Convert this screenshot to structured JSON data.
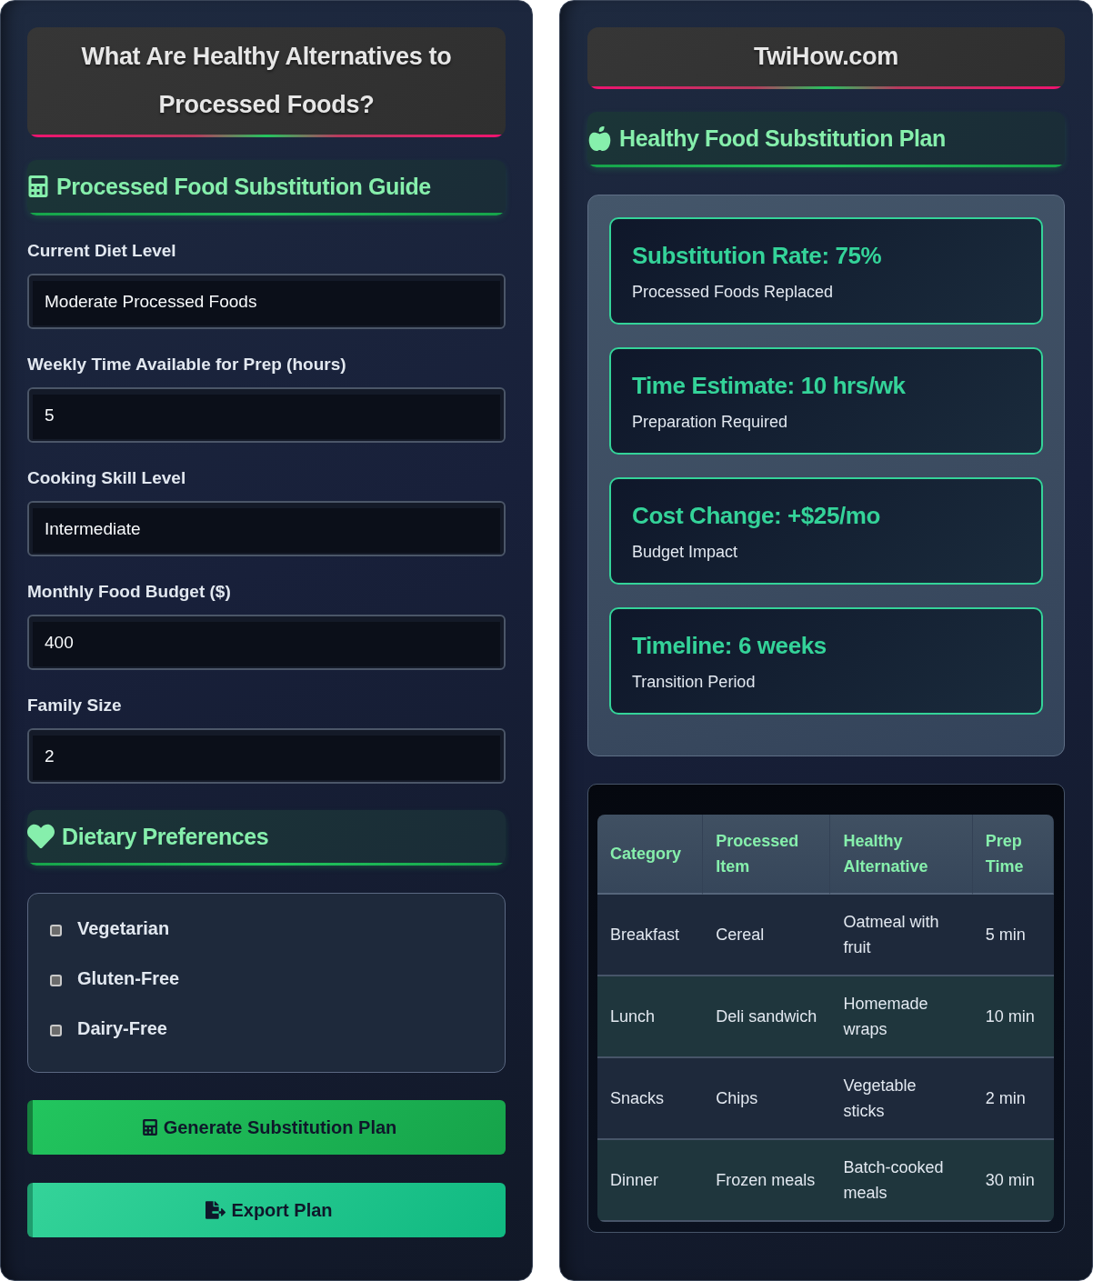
{
  "left_panel": {
    "title": "What Are Healthy Alternatives to Processed Foods?",
    "guide_header": "Processed Food Substitution Guide",
    "fields": [
      {
        "label": "Current Diet Level",
        "value": "Moderate Processed Foods"
      },
      {
        "label": "Weekly Time Available for Prep (hours)",
        "value": "5"
      },
      {
        "label": "Cooking Skill Level",
        "value": "Intermediate"
      },
      {
        "label": "Monthly Food Budget ($)",
        "value": "400"
      },
      {
        "label": "Family Size",
        "value": "2"
      }
    ],
    "preferences_header": "Dietary Preferences",
    "preferences": [
      {
        "label": "Vegetarian",
        "checked": false
      },
      {
        "label": "Gluten-Free",
        "checked": false
      },
      {
        "label": "Dairy-Free",
        "checked": false
      }
    ],
    "buttons": [
      {
        "kind": "generate",
        "label": "Generate Substitution Plan"
      },
      {
        "kind": "export",
        "label": "Export Plan"
      }
    ]
  },
  "right_panel": {
    "site_title": "TwiHow.com",
    "plan_header": "Healthy Food Substitution Plan",
    "results": [
      {
        "title": "Substitution Rate: 75%",
        "caption": "Processed Foods Replaced"
      },
      {
        "title": "Time Estimate: 10 hrs/wk",
        "caption": "Preparation Required"
      },
      {
        "title": "Cost Change: +$25/mo",
        "caption": "Budget Impact"
      },
      {
        "title": "Timeline: 6 weeks",
        "caption": "Transition Period"
      }
    ],
    "table": {
      "columns": [
        "Category",
        "Processed Item",
        "Healthy Alternative",
        "Prep Time"
      ],
      "rows": [
        [
          "Breakfast",
          "Cereal",
          "Oatmeal with fruit",
          "5 min"
        ],
        [
          "Lunch",
          "Deli sandwich",
          "Homemade wraps",
          "10 min"
        ],
        [
          "Snacks",
          "Chips",
          "Vegetable sticks",
          "2 min"
        ],
        [
          "Dinner",
          "Frozen meals",
          "Batch-cooked meals",
          "30 min"
        ]
      ]
    }
  }
}
